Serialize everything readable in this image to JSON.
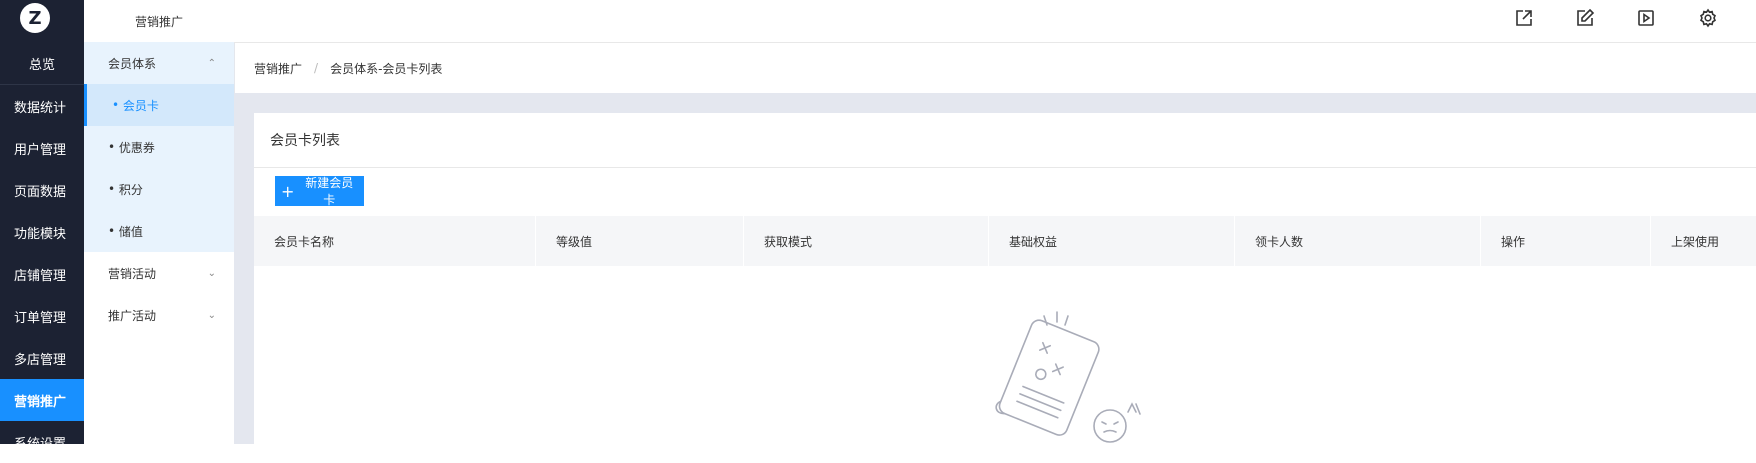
{
  "logo": {
    "glyph": "Z"
  },
  "rail": {
    "items": [
      {
        "label": "总览"
      },
      {
        "label": "数据统计"
      },
      {
        "label": "用户管理"
      },
      {
        "label": "页面数据"
      },
      {
        "label": "功能模块"
      },
      {
        "label": "店铺管理"
      },
      {
        "label": "订单管理"
      },
      {
        "label": "多店管理"
      },
      {
        "label": "营销推广"
      },
      {
        "label": "系统设置"
      }
    ],
    "active_index": 8
  },
  "submenu": {
    "title": "营销推广",
    "groups": [
      {
        "label": "会员体系",
        "expanded": true,
        "children": [
          "会员卡",
          "优惠券",
          "积分",
          "储值"
        ]
      },
      {
        "label": "营销活动",
        "expanded": false
      },
      {
        "label": "推广活动",
        "expanded": false
      }
    ],
    "active_child": "会员卡"
  },
  "topbar": {
    "icons": [
      "external-link-icon",
      "edit-icon",
      "play-icon",
      "gear-icon"
    ]
  },
  "breadcrumb": {
    "items": [
      "营销推广",
      "会员体系-会员卡列表"
    ],
    "separator": "/"
  },
  "card": {
    "title": "会员卡列表",
    "new_button": "新建会员卡",
    "columns": [
      "会员卡名称",
      "等级值",
      "获取模式",
      "基础权益",
      "领卡人数",
      "操作",
      "上架使用"
    ]
  },
  "colors": {
    "primary": "#1890ff",
    "rail_bg": "#1c2233",
    "submenu_bg": "#e8f3fd",
    "content_bg": "#e4e7ef"
  }
}
